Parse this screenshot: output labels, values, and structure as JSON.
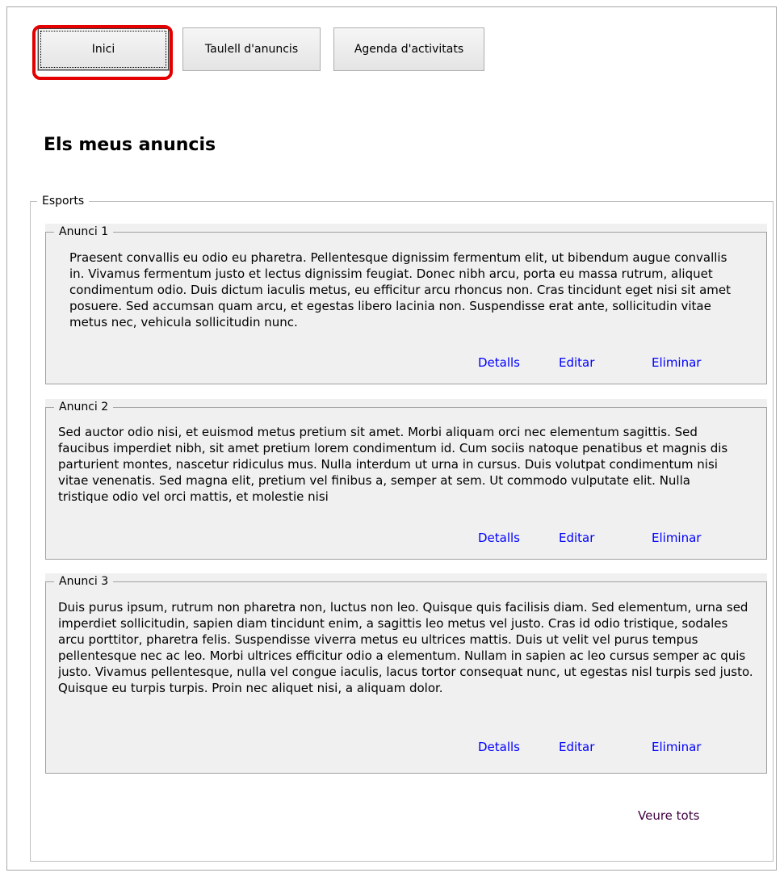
{
  "nav": {
    "buttons": [
      {
        "label": "Inici"
      },
      {
        "label": "Taulell d'anuncis"
      },
      {
        "label": "Agenda d'activitats"
      }
    ]
  },
  "heading": "Els meus anuncis",
  "group": {
    "legend": "Esports"
  },
  "ads": [
    {
      "title": "Anunci 1",
      "text": "Praesent convallis eu odio eu pharetra. Pellentesque dignissim fermentum elit, ut bibendum augue convallis in. Vivamus fermentum justo et lectus dignissim feugiat. Donec nibh arcu, porta eu massa rutrum, aliquet condimentum odio. Duis dictum iaculis metus, eu efficitur arcu rhoncus non. Cras tincidunt eget nisi sit amet posuere. Sed accumsan quam arcu, et egestas libero lacinia non. Suspendisse erat ante, sollicitudin vitae metus nec, vehicula sollicitudin nunc.",
      "details": "Detalls",
      "edit": "Editar",
      "delete": "Eliminar"
    },
    {
      "title": "Anunci 2",
      "text": "Sed auctor odio nisi, et euismod metus pretium sit amet. Morbi aliquam orci nec elementum sagittis. Sed faucibus imperdiet nibh, sit amet pretium lorem condimentum id. Cum sociis natoque penatibus et magnis dis parturient montes, nascetur ridiculus mus. Nulla interdum ut urna in cursus. Duis volutpat condimentum nisi vitae venenatis. Sed magna elit, pretium vel finibus a, semper at sem. Ut commodo vulputate elit. Nulla tristique odio vel orci mattis, et molestie nisi",
      "details": "Detalls",
      "edit": "Editar",
      "delete": "Eliminar"
    },
    {
      "title": "Anunci 3",
      "text": "Duis purus ipsum, rutrum non pharetra non, luctus non leo. Quisque quis facilisis diam. Sed elementum, urna sed imperdiet sollicitudin, sapien diam tincidunt enim, a sagittis leo metus vel justo. Cras id odio tristique, sodales arcu porttitor, pharetra felis. Suspendisse viverra metus eu ultrices mattis. Duis ut velit vel purus tempus pellentesque nec ac leo. Morbi ultrices efficitur odio a elementum. Nullam in sapien ac leo cursus semper ac quis justo. Vivamus pellentesque, nulla vel congue iaculis, lacus tortor consequat nunc, ut egestas nisl turpis sed justo. Quisque eu turpis turpis. Proin nec aliquet nisi, a aliquam dolor.",
      "details": "Detalls",
      "edit": "Editar",
      "delete": "Eliminar"
    }
  ],
  "see_all": "Veure tots",
  "colors": {
    "highlight": "#e50000",
    "link": "#0000ff",
    "see_all": "#400040",
    "ad_background": "#f0f0f0"
  }
}
